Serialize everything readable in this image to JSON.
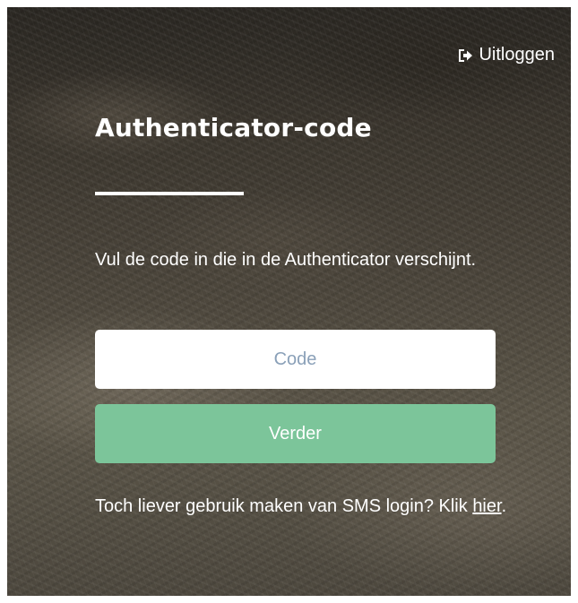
{
  "header": {
    "logout_label": "Uitloggen",
    "logout_icon": "sign-out-icon"
  },
  "main": {
    "title": "Authenticator-code",
    "description": "Vul de code in die in de Authenticator verschijnt.",
    "code_input": {
      "placeholder": "Code",
      "value": ""
    },
    "submit_label": "Verder",
    "sms_text_before": "Toch liever gebruik maken van SMS login? Klik ",
    "sms_link_label": "hier",
    "sms_text_after": "."
  },
  "colors": {
    "submit_button": "#7cc59a",
    "text": "#ffffff",
    "input_placeholder": "#8aa0b8"
  }
}
